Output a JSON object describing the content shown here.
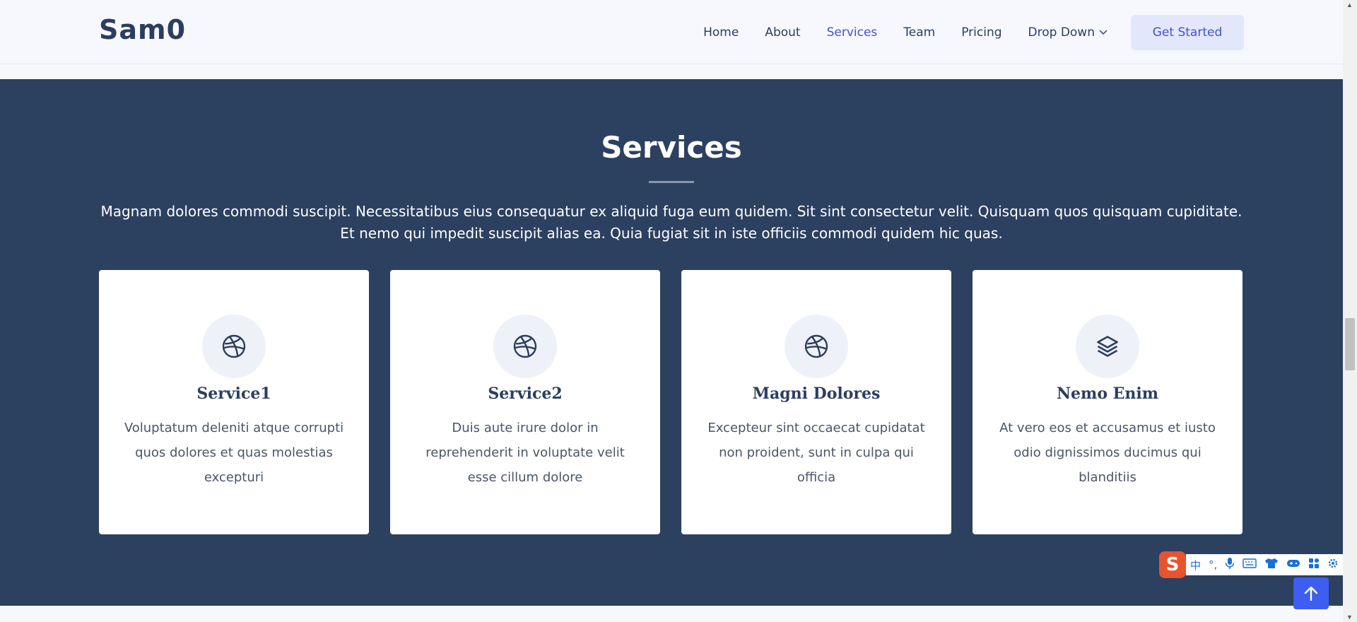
{
  "header": {
    "logo": "Sam0",
    "nav": [
      {
        "label": "Home"
      },
      {
        "label": "About"
      },
      {
        "label": "Services"
      },
      {
        "label": "Team"
      },
      {
        "label": "Pricing"
      },
      {
        "label": "Drop Down"
      }
    ],
    "active_item": "Services",
    "cta_label": "Get Started"
  },
  "services": {
    "title": "Services",
    "intro": "Magnam dolores commodi suscipit. Necessitatibus eius consequatur ex aliquid fuga eum quidem. Sit sint consectetur velit. Quisquam quos quisquam cupiditate. Et nemo qui impedit suscipit alias ea. Quia fugiat sit in iste officiis commodi quidem hic quas.",
    "cards": [
      {
        "icon": "dribbble-icon",
        "title": "Service1",
        "desc": "Voluptatum deleniti atque corrupti quos dolores et quas molestias excepturi"
      },
      {
        "icon": "dribbble-icon",
        "title": "Service2",
        "desc": "Duis aute irure dolor in reprehenderit in voluptate velit esse cillum dolore"
      },
      {
        "icon": "dribbble-icon",
        "title": "Magni Dolores",
        "desc": "Excepteur sint occaecat cupidatat non proident, sunt in culpa qui officia"
      },
      {
        "icon": "layers-icon",
        "title": "Nemo Enim",
        "desc": "At vero eos et accusamus et iusto odio dignissimos ducimus qui blanditiis"
      }
    ]
  },
  "ime_toolbar": {
    "logo": "S",
    "buttons": [
      "中",
      "°,",
      "mic-icon",
      "keyboard-icon",
      "shirt-icon",
      "gamepad-icon",
      "apps-icon",
      "settings-icon"
    ]
  },
  "colors": {
    "primary": "#4154c5",
    "section_bg": "#2c4060",
    "cta_bg": "#e3e7fb",
    "back_to_top": "#3d5ef0"
  }
}
